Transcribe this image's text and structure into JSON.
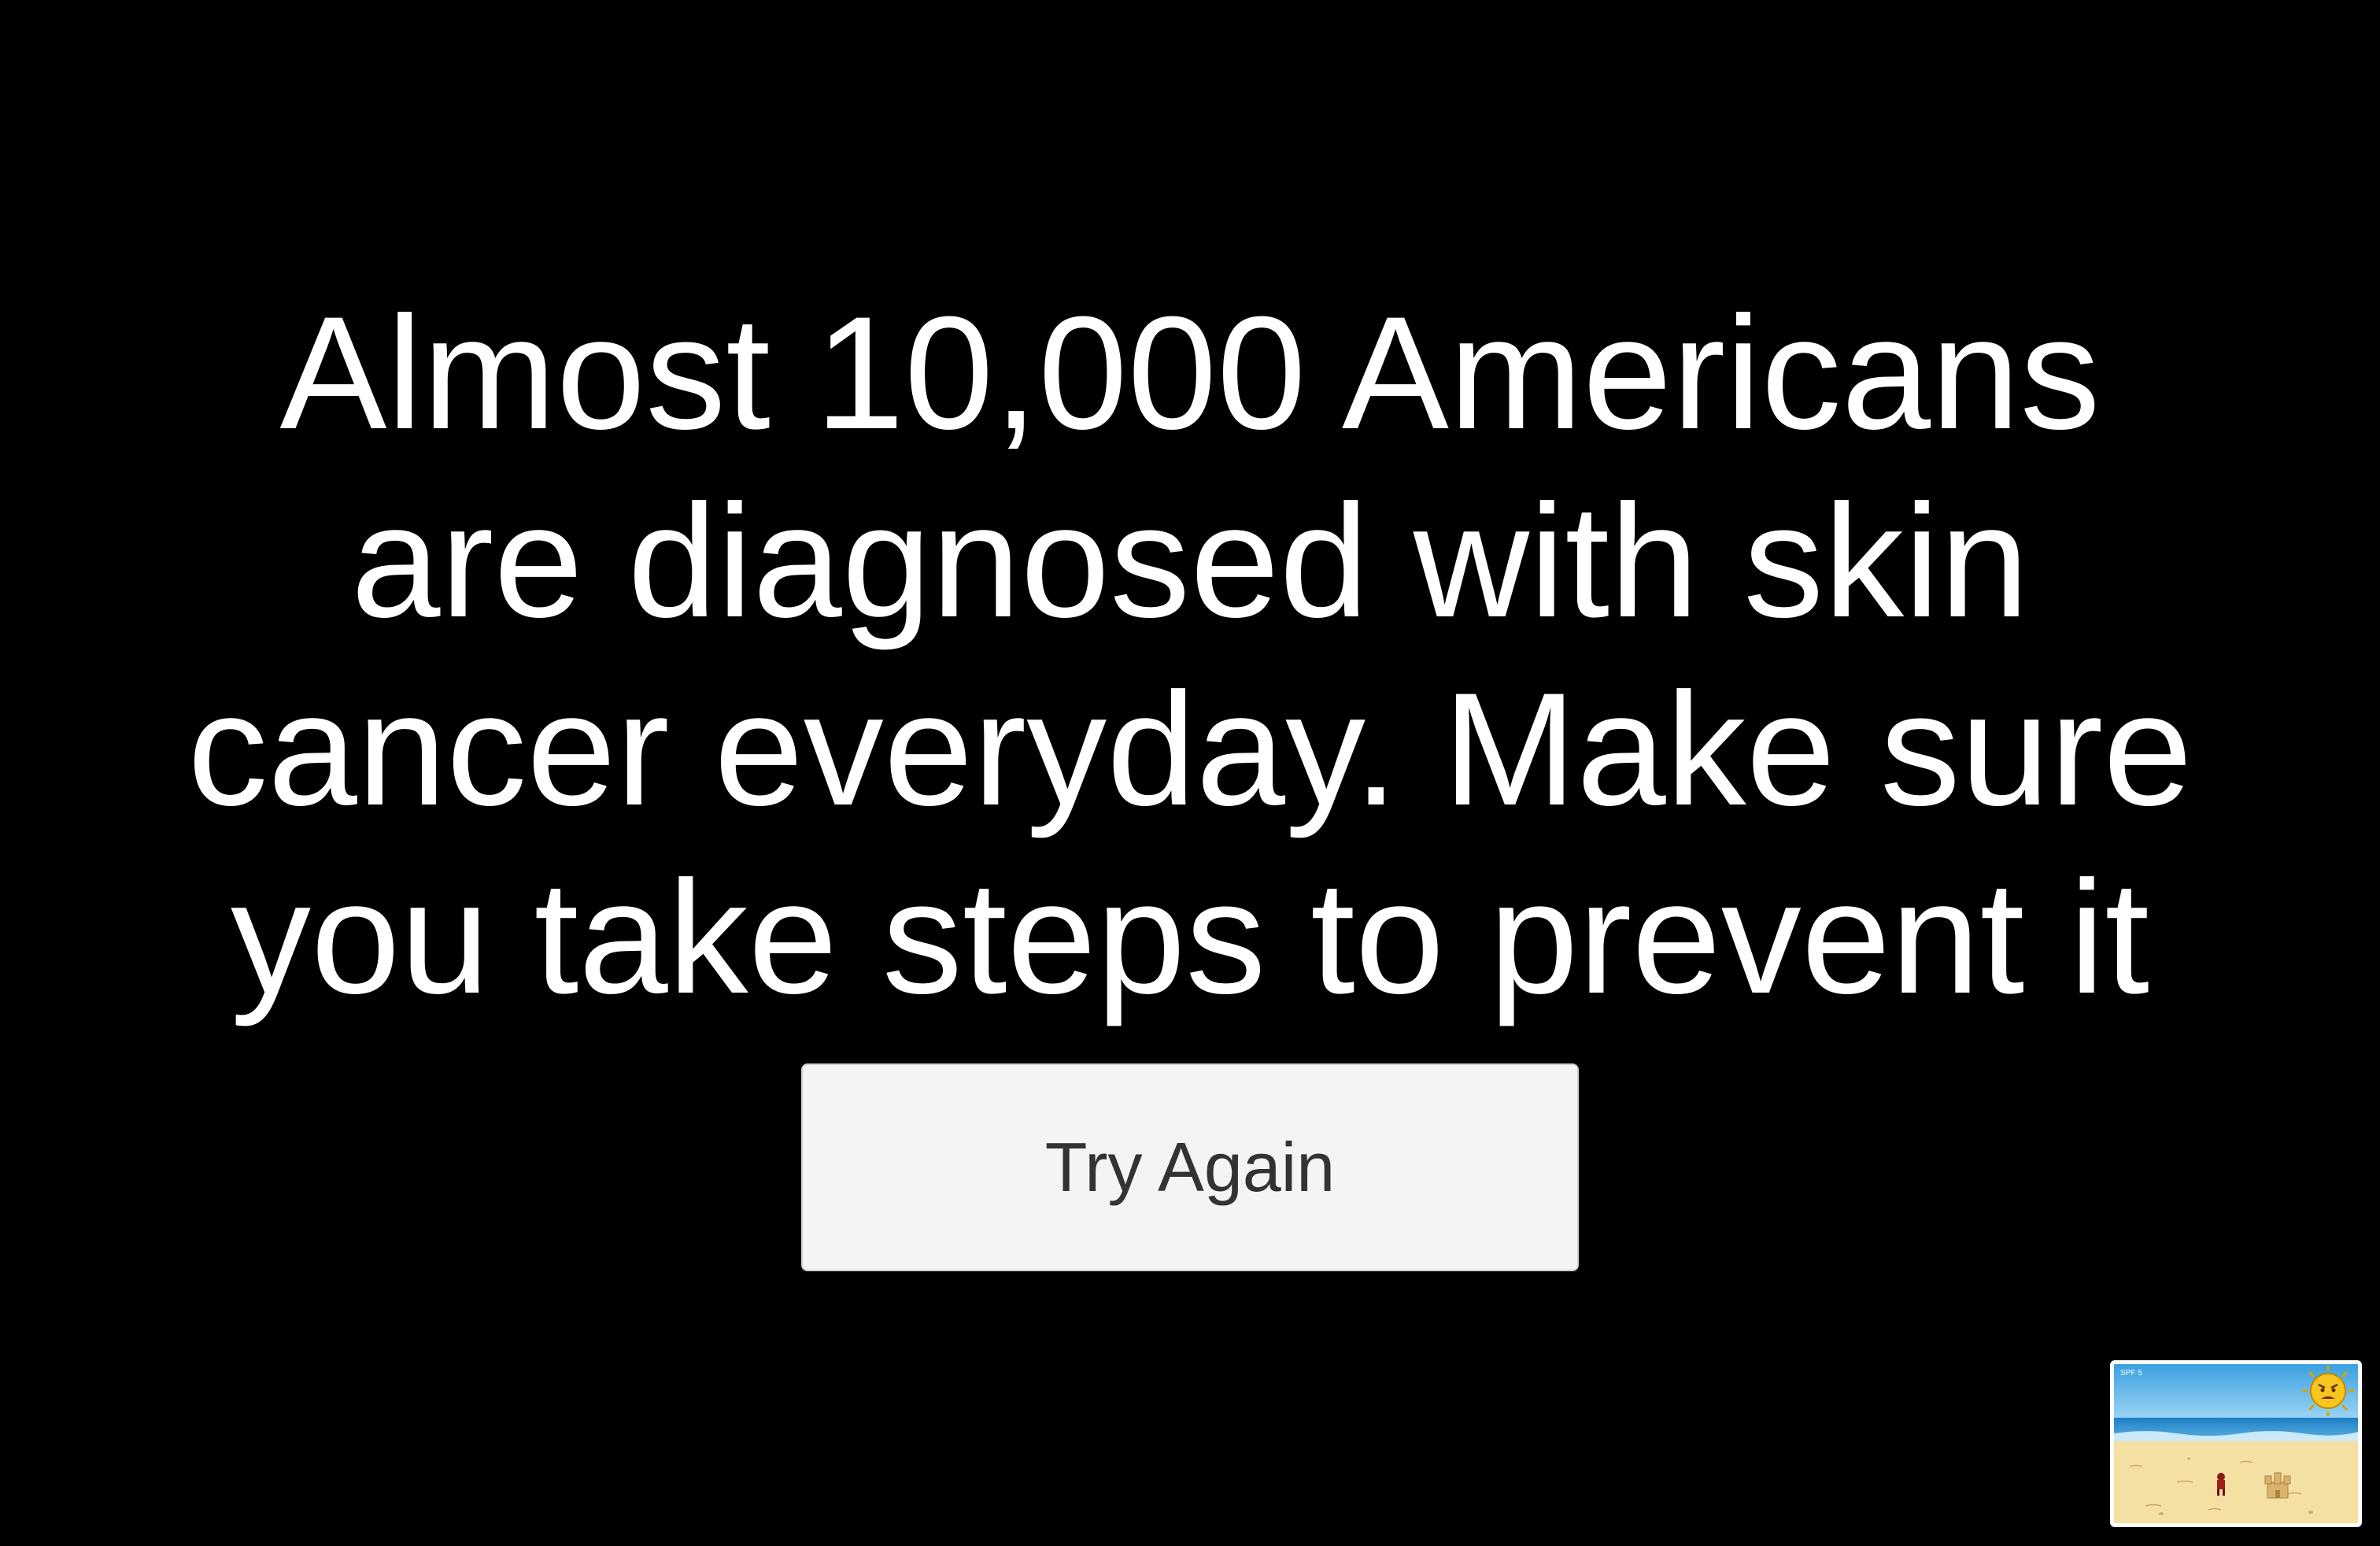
{
  "message": {
    "lines": [
      "Almost 10,000 Americans",
      "are diagnosed with skin",
      "cancer everyday. Make sure",
      "you take steps to prevent it"
    ]
  },
  "button": {
    "label": "Try Again"
  },
  "thumbnail": {
    "hud_text": "SPF 5"
  },
  "colors": {
    "background": "#000000",
    "text": "#ffffff",
    "button_bg": "#f4f4f4",
    "button_text": "#333333"
  }
}
